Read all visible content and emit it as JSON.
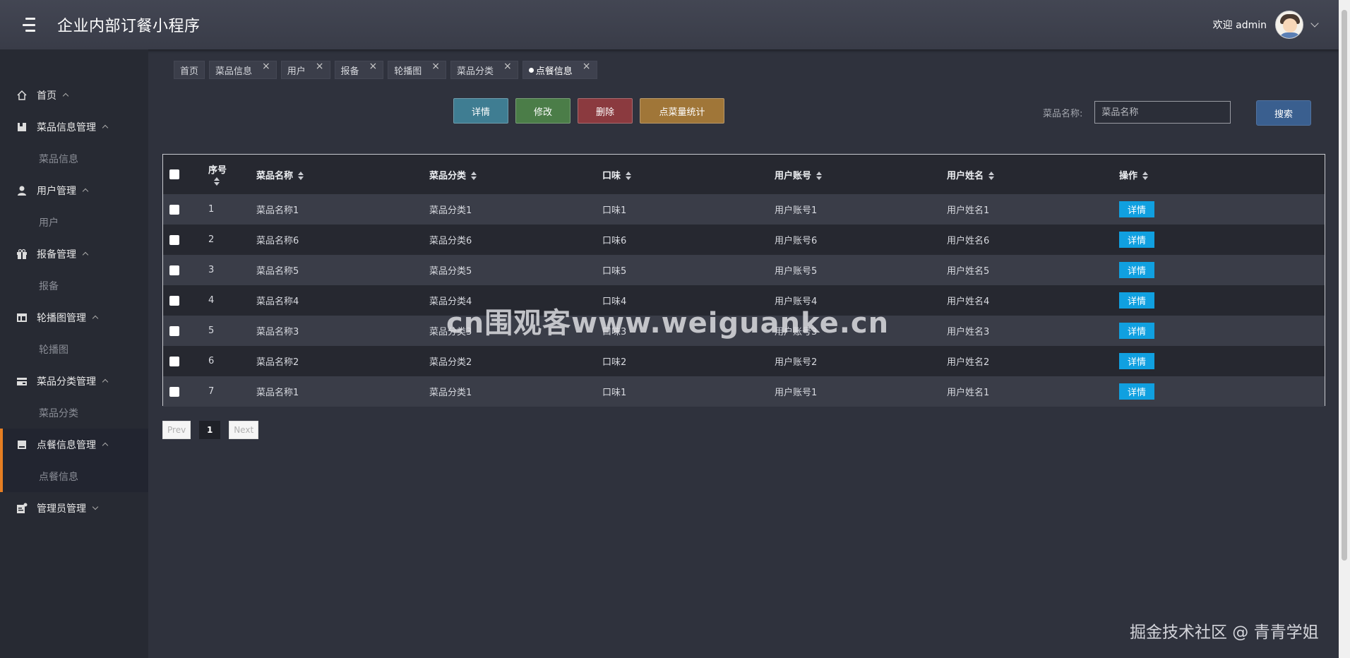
{
  "header": {
    "title": "企业内部订餐小程序",
    "welcome": "欢迎 admin"
  },
  "sidebar": {
    "groups": [
      {
        "label": "首页",
        "icon": "home-icon",
        "child": ""
      },
      {
        "label": "菜品信息管理",
        "icon": "book-icon",
        "child": "菜品信息"
      },
      {
        "label": "用户管理",
        "icon": "user-icon",
        "child": "用户"
      },
      {
        "label": "报备管理",
        "icon": "gift-icon",
        "child": "报备"
      },
      {
        "label": "轮播图管理",
        "icon": "grid-icon",
        "child": "轮播图"
      },
      {
        "label": "菜品分类管理",
        "icon": "card-icon",
        "child": "菜品分类"
      },
      {
        "label": "点餐信息管理",
        "icon": "book-icon",
        "child": "点餐信息"
      },
      {
        "label": "管理员管理",
        "icon": "admin-icon",
        "child": ""
      }
    ]
  },
  "tabs": [
    "首页",
    "菜品信息",
    "用户",
    "报备",
    "轮播图",
    "菜品分类",
    "点餐信息"
  ],
  "toolbar": {
    "detail": "详情",
    "edit": "修改",
    "delete": "删除",
    "stat": "点菜量统计"
  },
  "search": {
    "label": "菜品名称:",
    "placeholder": "菜品名称",
    "button": "搜索"
  },
  "table": {
    "headers": [
      "序号",
      "菜品名称",
      "菜品分类",
      "口味",
      "用户账号",
      "用户姓名",
      "操作"
    ],
    "row_button": "详情",
    "rows": [
      [
        "1",
        "菜品名称1",
        "菜品分类1",
        "口味1",
        "用户账号1",
        "用户姓名1"
      ],
      [
        "2",
        "菜品名称6",
        "菜品分类6",
        "口味6",
        "用户账号6",
        "用户姓名6"
      ],
      [
        "3",
        "菜品名称5",
        "菜品分类5",
        "口味5",
        "用户账号5",
        "用户姓名5"
      ],
      [
        "4",
        "菜品名称4",
        "菜品分类4",
        "口味4",
        "用户账号4",
        "用户姓名4"
      ],
      [
        "5",
        "菜品名称3",
        "菜品分类3",
        "口味3",
        "用户账号3",
        "用户姓名3"
      ],
      [
        "6",
        "菜品名称2",
        "菜品分类2",
        "口味2",
        "用户账号2",
        "用户姓名2"
      ],
      [
        "7",
        "菜品名称1",
        "菜品分类1",
        "口味1",
        "用户账号1",
        "用户姓名1"
      ]
    ]
  },
  "pagination": {
    "prev": "Prev",
    "page": "1",
    "next": "Next"
  },
  "watermarks": {
    "center": "cn围观客www.weiguanke.cn",
    "corner": "掘金技术社区 @ 青青学姐"
  },
  "colors": {
    "accent": "#e67e22",
    "row_button": "#10a0e0",
    "search_button": "#3a5f8f"
  }
}
